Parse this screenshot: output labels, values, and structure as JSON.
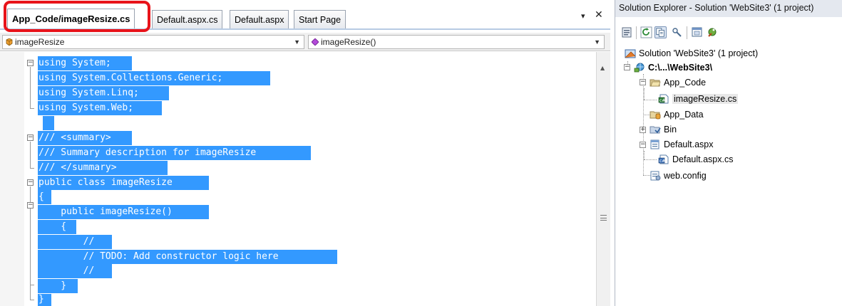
{
  "editor": {
    "tabs": [
      {
        "label": "App_Code/imageResize.cs",
        "active": true
      },
      {
        "label": "Default.aspx.cs",
        "active": false
      },
      {
        "label": "Default.aspx",
        "active": false
      },
      {
        "label": "Start Page",
        "active": false
      }
    ],
    "pane_controls": {
      "dropdown": "▾",
      "close": "✕"
    },
    "nav": {
      "type_combo": "imageResize",
      "member_combo": "imageResize()"
    },
    "code_lines": [
      "using System;",
      "using System.Collections.Generic;",
      "using System.Linq;",
      "using System.Web;",
      "",
      "/// <summary>",
      "/// Summary description for imageResize",
      "/// </summary>",
      "public class imageResize",
      "{",
      "    public imageResize()",
      "    {",
      "        //",
      "        // TODO: Add constructor logic here",
      "        //",
      "    }",
      "}"
    ]
  },
  "solution_explorer": {
    "title": "Solution Explorer - Solution 'WebSite3' (1 project)",
    "tree": [
      {
        "label": "Solution 'WebSite3' (1 project)",
        "icon": "solution-icon"
      },
      {
        "label": "C:\\...\\WebSite3\\",
        "icon": "website-icon"
      },
      {
        "label": "App_Code",
        "icon": "folder-open-icon"
      },
      {
        "label": "imageResize.cs",
        "icon": "csharp-file-icon"
      },
      {
        "label": "App_Data",
        "icon": "data-folder-icon"
      },
      {
        "label": "Bin",
        "icon": "bin-folder-icon"
      },
      {
        "label": "Default.aspx",
        "icon": "aspx-page-icon"
      },
      {
        "label": "Default.aspx.cs",
        "icon": "csharp-codebehind-icon"
      },
      {
        "label": "web.config",
        "icon": "config-file-icon"
      }
    ]
  },
  "colors": {
    "selection": "#3399ff",
    "highlight_box": "#e8131a"
  }
}
